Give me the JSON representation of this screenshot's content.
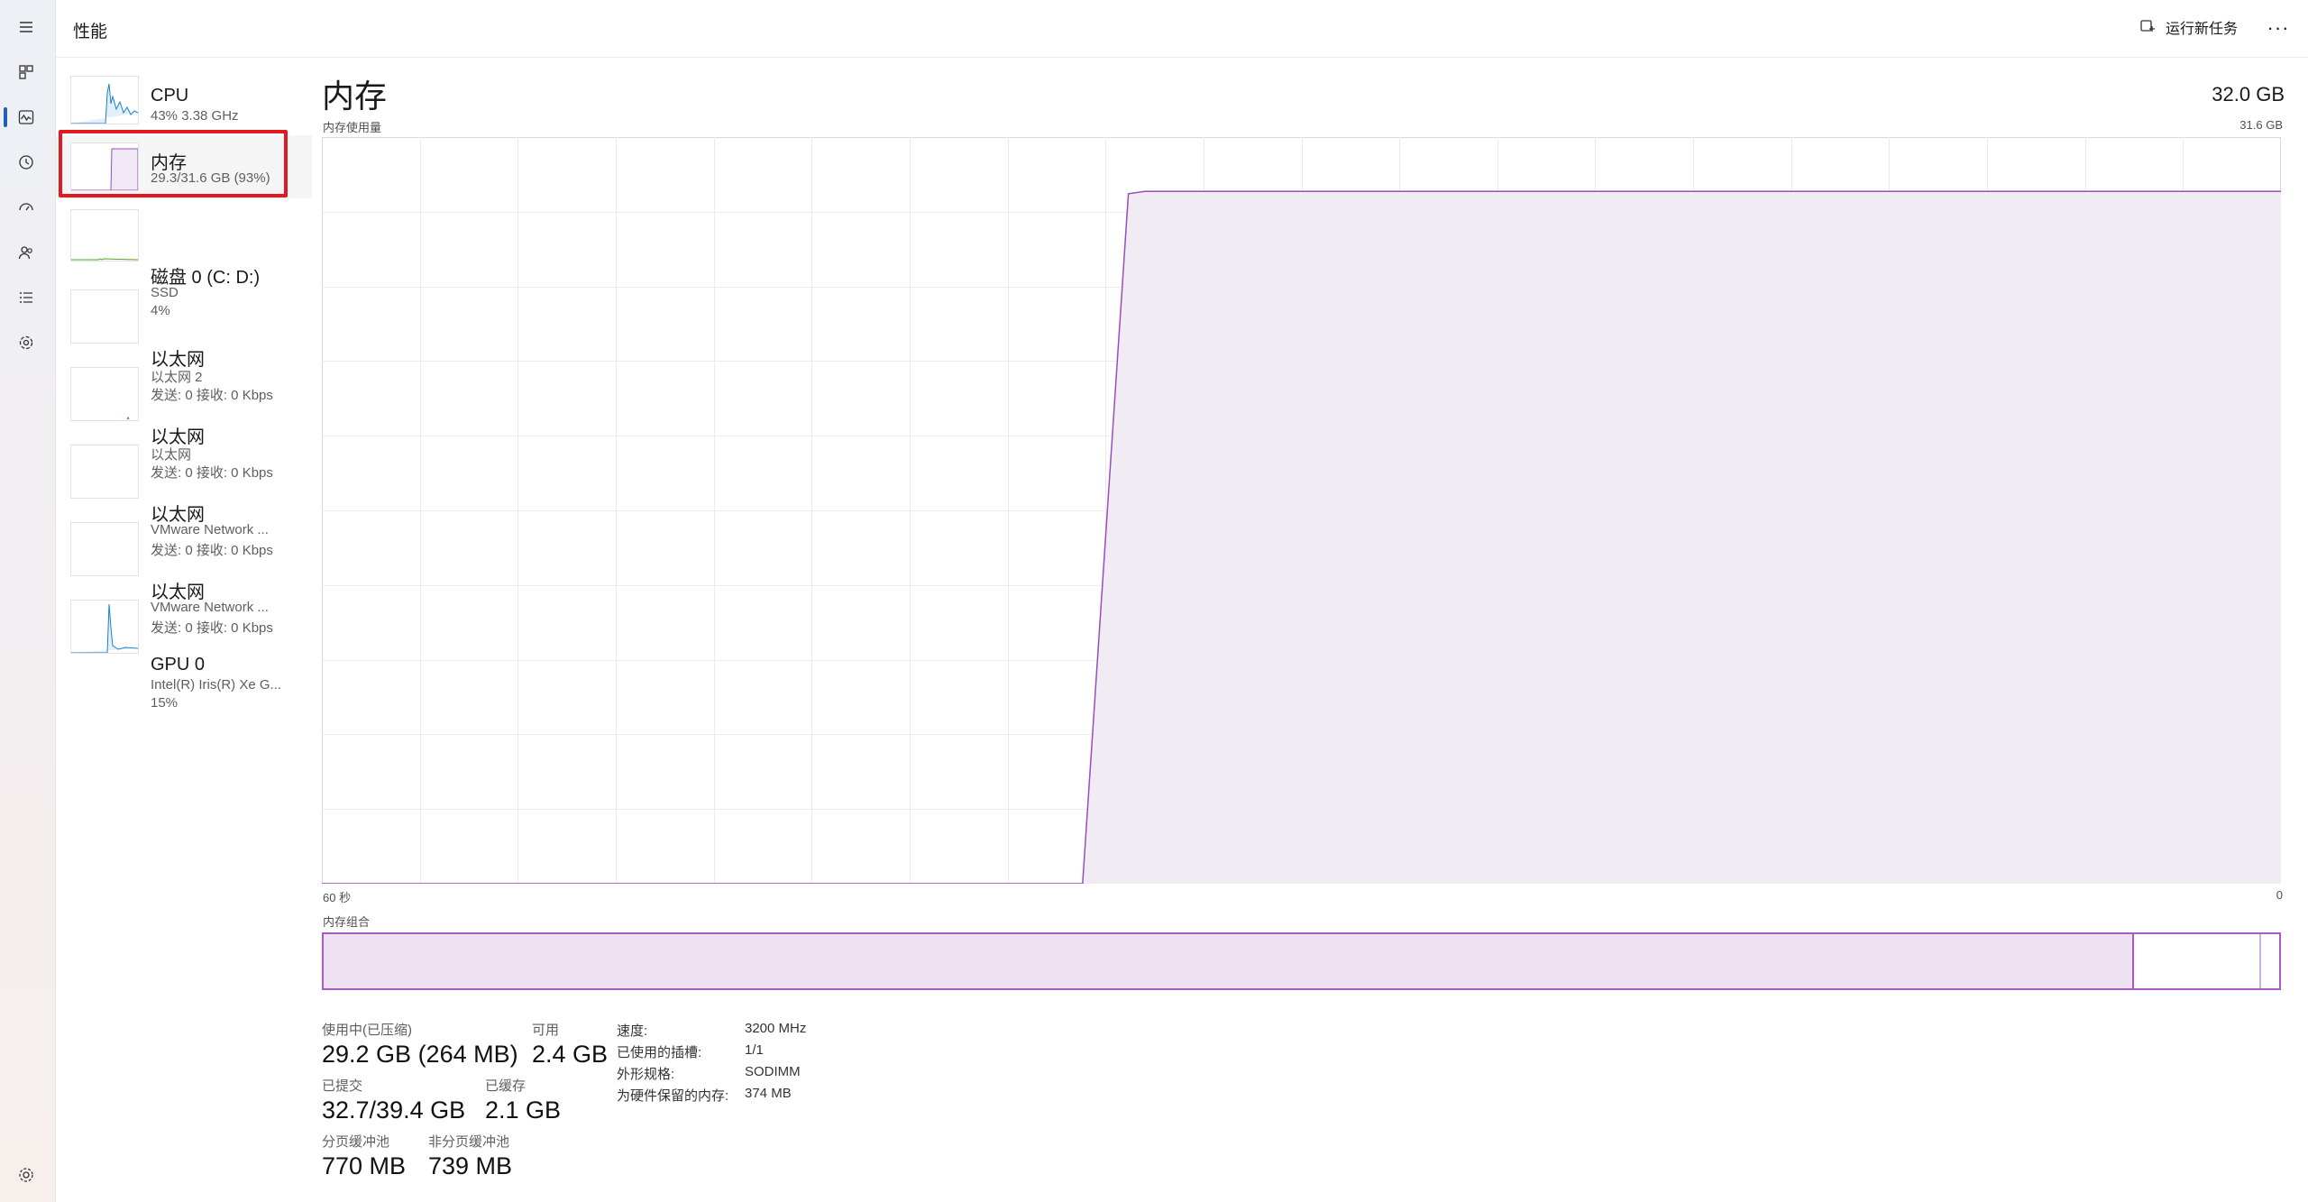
{
  "header": {
    "title": "性能",
    "run_task_label": "运行新任务",
    "more_label": "···"
  },
  "nav": {
    "items": [
      {
        "name": "menu-icon"
      },
      {
        "name": "processes-icon"
      },
      {
        "name": "performance-icon"
      },
      {
        "name": "app-history-icon"
      },
      {
        "name": "startup-apps-icon"
      },
      {
        "name": "users-icon"
      },
      {
        "name": "details-icon"
      },
      {
        "name": "services-icon"
      },
      {
        "name": "settings-icon"
      }
    ],
    "active": "performance-icon"
  },
  "devices": [
    {
      "name": "CPU",
      "line1": "43%  3.38 GHz",
      "line2": "",
      "color": "#1a7fd1",
      "selected": false
    },
    {
      "name": "内存",
      "line1": "29.3/31.6 GB (93%)",
      "line2": "",
      "color": "#9b4cc0",
      "selected": true
    },
    {
      "name": "磁盘 0 (C: D:)",
      "line1": "SSD",
      "line2": "4%",
      "color": "#4fa81f",
      "selected": false
    },
    {
      "name": "以太网",
      "line1": "以太网 2",
      "line2": "发送: 0 接收: 0 Kbps",
      "color": "#a7661f",
      "selected": false
    },
    {
      "name": "以太网",
      "line1": "以太网",
      "line2": "发送: 0 接收: 0 Kbps",
      "color": "#a7661f",
      "selected": false
    },
    {
      "name": "以太网",
      "line1": "VMware Network ...",
      "line2": "发送: 0 接收: 0 Kbps",
      "color": "#a7661f",
      "selected": false
    },
    {
      "name": "以太网",
      "line1": "VMware Network ...",
      "line2": "发送: 0 接收: 0 Kbps",
      "color": "#a7661f",
      "selected": false
    },
    {
      "name": "GPU 0",
      "line1": "Intel(R) Iris(R) Xe G...",
      "line2": "15%",
      "color": "#1a7fd1",
      "selected": false
    }
  ],
  "memory": {
    "title": "内存",
    "total": "32.0 GB",
    "usage_label": "内存使用量",
    "usage_max": "31.6 GB",
    "axis_left": "60 秒",
    "axis_right": "0",
    "composition_label": "内存组合",
    "composition": {
      "in_use_fraction": 0.925,
      "modified_fraction": 0.065
    },
    "stats": {
      "in_use_label": "使用中(已压缩)",
      "in_use_value": "29.2 GB (264 MB)",
      "available_label": "可用",
      "available_value": "2.4 GB",
      "committed_label": "已提交",
      "committed_value": "32.7/39.4 GB",
      "cached_label": "已缓存",
      "cached_value": "2.1 GB",
      "paged_pool_label": "分页缓冲池",
      "paged_pool_value": "770 MB",
      "nonpaged_pool_label": "非分页缓冲池",
      "nonpaged_pool_value": "739 MB"
    },
    "details": {
      "speed_label": "速度:",
      "speed_value": "3200 MHz",
      "slots_label": "已使用的插槽:",
      "slots_value": "1/1",
      "form_factor_label": "外形规格:",
      "form_factor_value": "SODIMM",
      "reserved_label": "为硬件保留的内存:",
      "reserved_value": "374 MB"
    }
  },
  "chart_data": {
    "type": "area",
    "title": "内存使用量",
    "xlabel": "",
    "ylabel": "",
    "x_range": [
      60,
      0
    ],
    "ylim": [
      0,
      31.6
    ],
    "x": [
      60,
      36.7,
      35.3,
      34.8,
      0
    ],
    "series": [
      {
        "values": [
          0,
          0,
          29.2,
          29.3,
          29.3
        ],
        "color": "#9b4cc0"
      }
    ],
    "grid": true
  }
}
